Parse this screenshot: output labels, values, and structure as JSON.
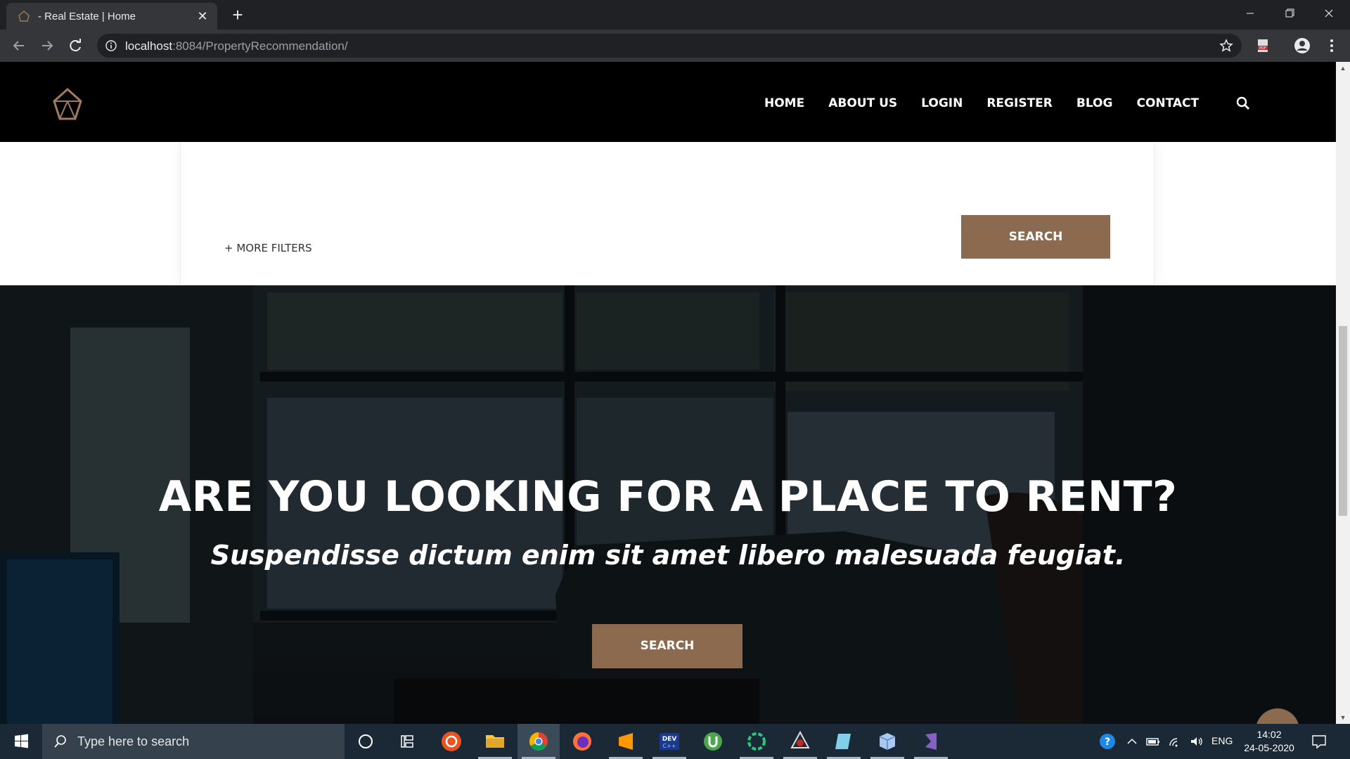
{
  "browser": {
    "tab_title": "- Real Estate | Home",
    "url_host": "localhost",
    "url_rest": ":8084/PropertyRecommendation/"
  },
  "header": {
    "nav": [
      "HOME",
      "ABOUT US",
      "LOGIN",
      "REGISTER",
      "BLOG",
      "CONTACT"
    ]
  },
  "filters": {
    "more_label": "+ MORE FILTERS",
    "search_label": "SEARCH"
  },
  "hero": {
    "title": "ARE YOU LOOKING FOR A PLACE TO RENT?",
    "subtitle": "Suspendisse dictum enim sit amet libero malesuada feugiat.",
    "search_label": "SEARCH"
  },
  "taskbar": {
    "search_placeholder": "Type here to search",
    "lang": "ENG",
    "time": "14:02",
    "date": "24-05-2020",
    "apps": [
      "task-view-icon",
      "ubuntu-icon",
      "file-explorer-icon",
      "chrome-icon",
      "firefox-icon",
      "sublime-text-icon",
      "devc-icon",
      "utorrent-icon",
      "circle-app-icon",
      "spider-app-icon",
      "notes-app-icon",
      "box-app-icon",
      "visual-studio-icon"
    ]
  },
  "colors": {
    "accent_brown": "#8b6a4f",
    "header_bg": "#000000"
  }
}
